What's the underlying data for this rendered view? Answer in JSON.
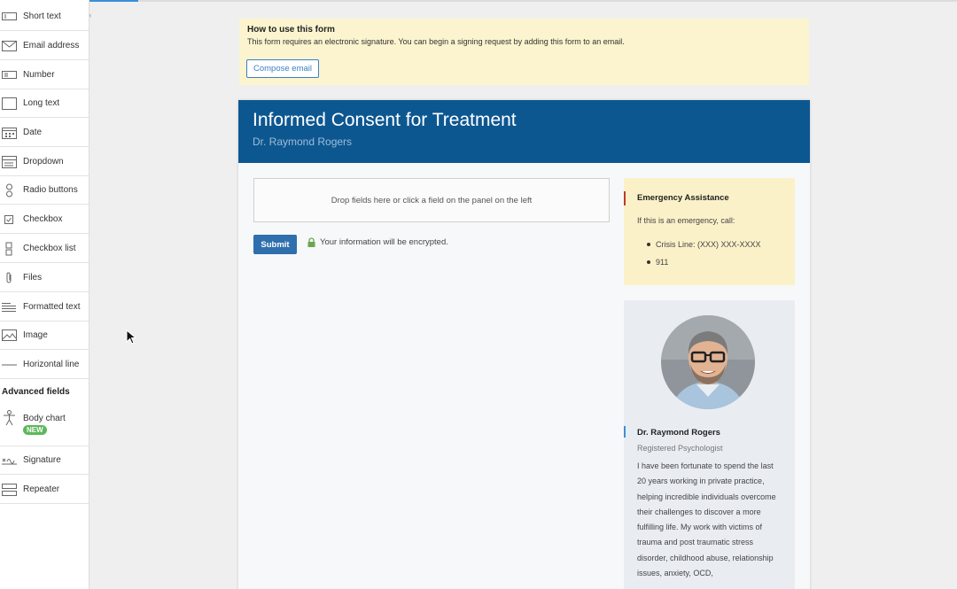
{
  "sidebar": {
    "collapse_label": "‹",
    "items": [
      {
        "label": "Short text",
        "icon": "short-text-icon"
      },
      {
        "label": "Email address",
        "icon": "email-icon"
      },
      {
        "label": "Number",
        "icon": "number-icon"
      },
      {
        "label": "Long text",
        "icon": "long-text-icon"
      },
      {
        "label": "Date",
        "icon": "calendar-icon"
      },
      {
        "label": "Dropdown",
        "icon": "dropdown-icon"
      },
      {
        "label": "Radio buttons",
        "icon": "radio-icon"
      },
      {
        "label": "Checkbox",
        "icon": "checkbox-icon"
      },
      {
        "label": "Checkbox list",
        "icon": "checkbox-list-icon"
      },
      {
        "label": "Files",
        "icon": "paperclip-icon"
      },
      {
        "label": "Formatted text",
        "icon": "formatted-text-icon"
      },
      {
        "label": "Image",
        "icon": "image-icon"
      },
      {
        "label": "Horizontal line",
        "icon": "horizontal-line-icon"
      }
    ],
    "advanced_heading": "Advanced fields",
    "advanced_items": [
      {
        "label": "Body chart",
        "badge": "NEW",
        "icon": "body-icon"
      },
      {
        "label": "Signature",
        "icon": "signature-icon"
      },
      {
        "label": "Repeater",
        "icon": "repeater-icon"
      }
    ]
  },
  "info": {
    "title": "How to use this form",
    "description": "This form requires an electronic signature. You can begin a signing request by adding this form to an email.",
    "button": "Compose email"
  },
  "form": {
    "title": "Informed Consent for Treatment",
    "subtitle": "Dr. Raymond Rogers",
    "drop_text": "Drop fields here or click a field on the panel on the left",
    "submit": "Submit",
    "encrypted": "Your information will be encrypted."
  },
  "emergency": {
    "title": "Emergency Assistance",
    "description": "If this is an emergency, call:",
    "items": [
      "Crisis Line: (XXX) XXX-XXXX",
      "911"
    ]
  },
  "profile": {
    "name": "Dr. Raymond Rogers",
    "role": "Registered Psychologist",
    "bio": "I have been fortunate to spend the last 20 years working in private practice, helping incredible individuals overcome their challenges to discover a more fulfilling life. My work with victims of trauma and post traumatic stress disorder, childhood abuse, relationship issues, anxiety, OCD,"
  },
  "colors": {
    "header": "#0d5791",
    "accent": "#2f6fad",
    "info_bg": "#fbf4cf",
    "emergency_bar": "#c0392b",
    "badge": "#5cb85c"
  }
}
